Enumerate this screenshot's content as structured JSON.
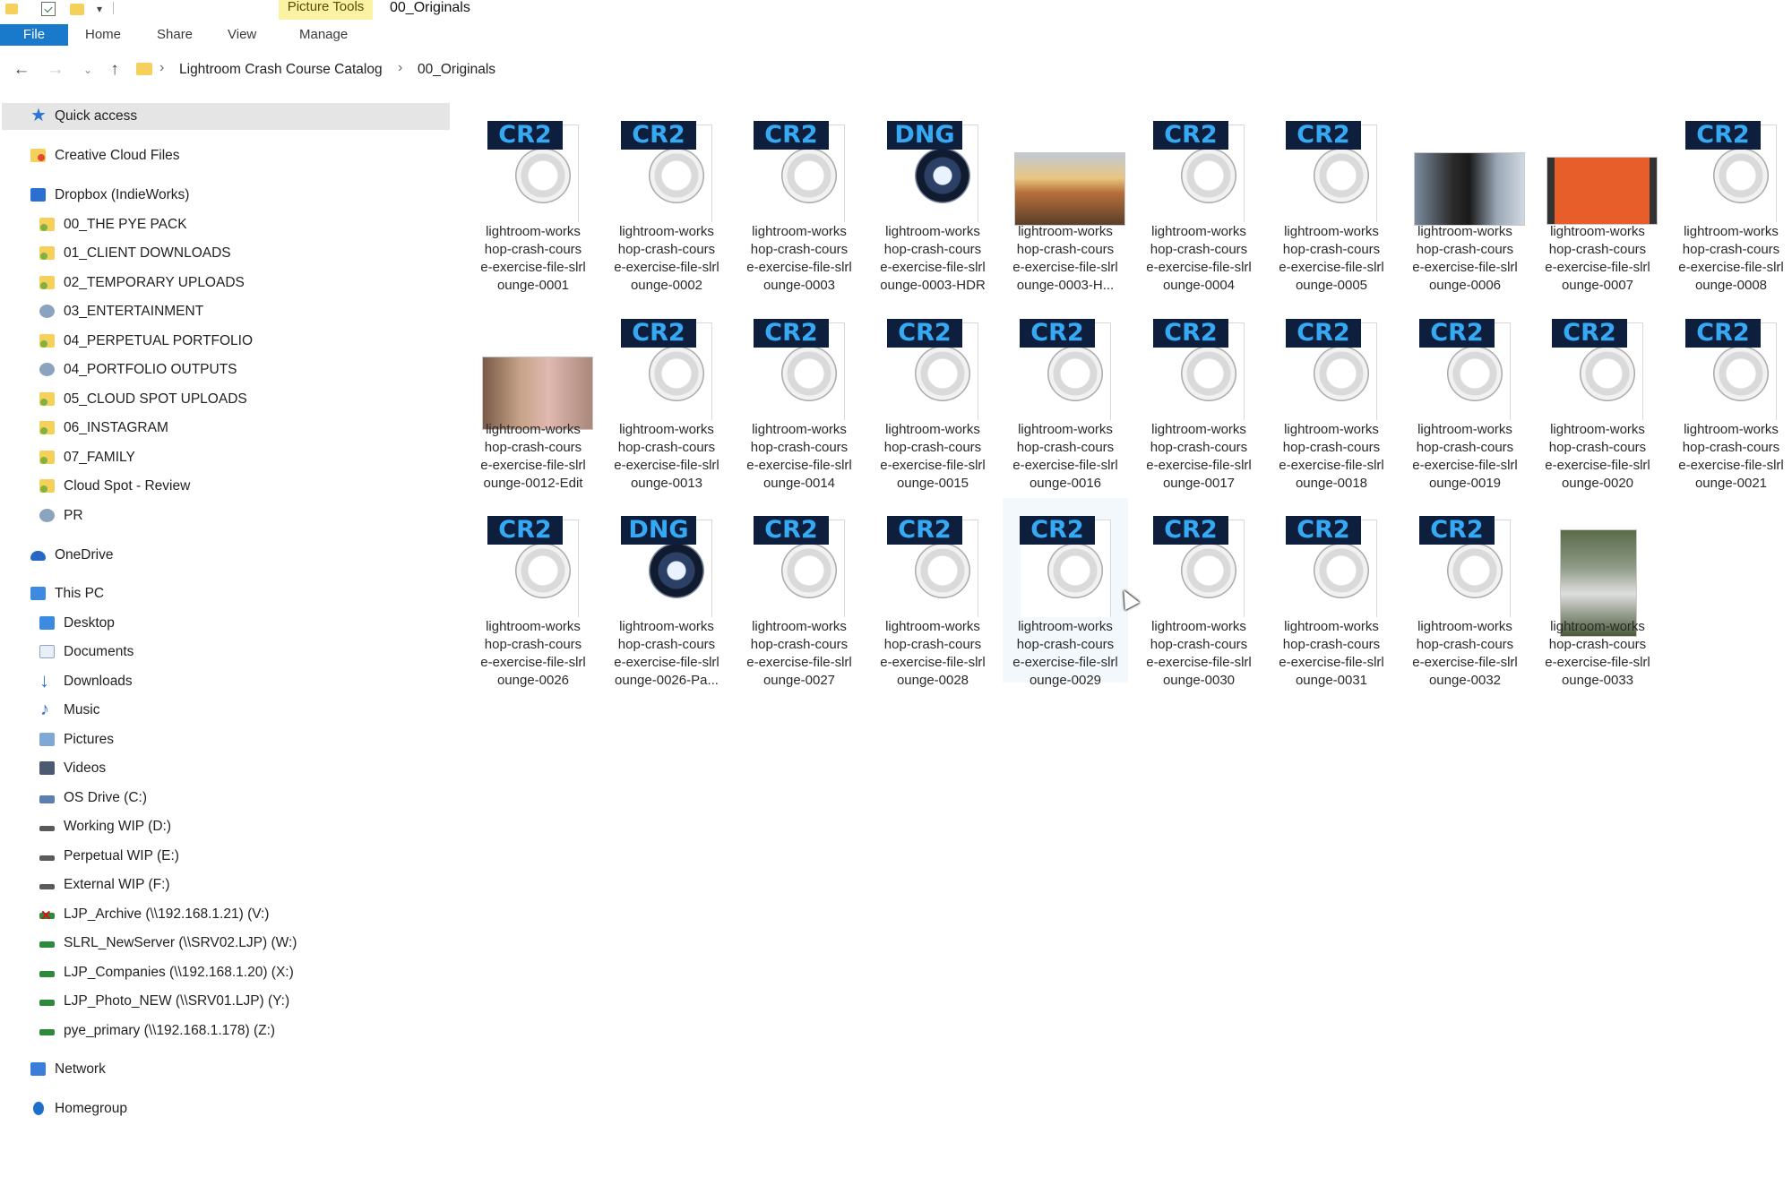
{
  "titlebar": {
    "context_tab": "Picture Tools",
    "window_title": "00_Originals"
  },
  "ribbon": {
    "tabs": [
      "File",
      "Home",
      "Share",
      "View",
      "Manage"
    ]
  },
  "address": {
    "crumbs": [
      "Lightroom Crash Course Catalog",
      "00_Originals"
    ]
  },
  "nav": {
    "quick_access": "Quick access",
    "creative_cloud": "Creative Cloud Files",
    "dropbox": "Dropbox (IndieWorks)",
    "dropbox_folders": [
      "00_THE PYE PACK",
      "01_CLIENT DOWNLOADS",
      "02_TEMPORARY UPLOADS",
      "03_ENTERTAINMENT",
      "04_PERPETUAL PORTFOLIO",
      "04_PORTFOLIO OUTPUTS",
      "05_CLOUD SPOT UPLOADS",
      "06_INSTAGRAM",
      "07_FAMILY",
      "Cloud Spot - Review",
      "PR"
    ],
    "onedrive": "OneDrive",
    "this_pc": "This PC",
    "pc_items": [
      "Desktop",
      "Documents",
      "Downloads",
      "Music",
      "Pictures",
      "Videos",
      "OS Drive (C:)",
      "Working WIP (D:)",
      "Perpetual WIP (E:)",
      "External WIP (F:)",
      "LJP_Archive (\\\\192.168.1.21) (V:)",
      "SLRL_NewServer (\\\\SRV02.LJP) (W:)",
      "LJP_Companies (\\\\192.168.1.20) (X:)",
      "LJP_Photo_NEW (\\\\SRV01.LJP) (Y:)",
      "pye_primary (\\\\192.168.1.178) (Z:)"
    ],
    "network": "Network",
    "homegroup": "Homegroup"
  },
  "files": [
    {
      "type": "CR2",
      "lines": [
        "lightroom-works",
        "hop-crash-cours",
        "e-exercise-file-slrl",
        "ounge-0001"
      ]
    },
    {
      "type": "CR2",
      "lines": [
        "lightroom-works",
        "hop-crash-cours",
        "e-exercise-file-slrl",
        "ounge-0002"
      ]
    },
    {
      "type": "CR2",
      "lines": [
        "lightroom-works",
        "hop-crash-cours",
        "e-exercise-file-slrl",
        "ounge-0003"
      ]
    },
    {
      "type": "DNG",
      "lines": [
        "lightroom-works",
        "hop-crash-cours",
        "e-exercise-file-slrl",
        "ounge-0003-HDR"
      ]
    },
    {
      "type": "photo",
      "lines": [
        "lightroom-works",
        "hop-crash-cours",
        "e-exercise-file-slrl",
        "ounge-0003-H..."
      ]
    },
    {
      "type": "CR2",
      "lines": [
        "lightroom-works",
        "hop-crash-cours",
        "e-exercise-file-slrl",
        "ounge-0004"
      ]
    },
    {
      "type": "CR2",
      "lines": [
        "lightroom-works",
        "hop-crash-cours",
        "e-exercise-file-slrl",
        "ounge-0005"
      ]
    },
    {
      "type": "photo",
      "lines": [
        "lightroom-works",
        "hop-crash-cours",
        "e-exercise-file-slrl",
        "ounge-0006"
      ]
    },
    {
      "type": "photo",
      "lines": [
        "lightroom-works",
        "hop-crash-cours",
        "e-exercise-file-slrl",
        "ounge-0007"
      ]
    },
    {
      "type": "CR2",
      "lines": [
        "lightroom-works",
        "hop-crash-cours",
        "e-exercise-file-slrl",
        "ounge-0008"
      ]
    },
    {
      "type": "photo",
      "lines": [
        "lightroom-works",
        "hop-crash-cours",
        "e-exercise-file-slrl",
        "ounge-0012-Edit"
      ]
    },
    {
      "type": "CR2",
      "lines": [
        "lightroom-works",
        "hop-crash-cours",
        "e-exercise-file-slrl",
        "ounge-0013"
      ]
    },
    {
      "type": "CR2",
      "lines": [
        "lightroom-works",
        "hop-crash-cours",
        "e-exercise-file-slrl",
        "ounge-0014"
      ]
    },
    {
      "type": "CR2",
      "lines": [
        "lightroom-works",
        "hop-crash-cours",
        "e-exercise-file-slrl",
        "ounge-0015"
      ]
    },
    {
      "type": "CR2",
      "lines": [
        "lightroom-works",
        "hop-crash-cours",
        "e-exercise-file-slrl",
        "ounge-0016"
      ]
    },
    {
      "type": "CR2",
      "lines": [
        "lightroom-works",
        "hop-crash-cours",
        "e-exercise-file-slrl",
        "ounge-0017"
      ]
    },
    {
      "type": "CR2",
      "lines": [
        "lightroom-works",
        "hop-crash-cours",
        "e-exercise-file-slrl",
        "ounge-0018"
      ]
    },
    {
      "type": "CR2",
      "lines": [
        "lightroom-works",
        "hop-crash-cours",
        "e-exercise-file-slrl",
        "ounge-0019"
      ]
    },
    {
      "type": "CR2",
      "lines": [
        "lightroom-works",
        "hop-crash-cours",
        "e-exercise-file-slrl",
        "ounge-0020"
      ]
    },
    {
      "type": "CR2",
      "lines": [
        "lightroom-works",
        "hop-crash-cours",
        "e-exercise-file-slrl",
        "ounge-0021"
      ]
    },
    {
      "type": "CR2",
      "lines": [
        "lightroom-works",
        "hop-crash-cours",
        "e-exercise-file-slrl",
        "ounge-0026"
      ]
    },
    {
      "type": "DNG",
      "lines": [
        "lightroom-works",
        "hop-crash-cours",
        "e-exercise-file-slrl",
        "ounge-0026-Pa..."
      ]
    },
    {
      "type": "CR2",
      "lines": [
        "lightroom-works",
        "hop-crash-cours",
        "e-exercise-file-slrl",
        "ounge-0027"
      ]
    },
    {
      "type": "CR2",
      "lines": [
        "lightroom-works",
        "hop-crash-cours",
        "e-exercise-file-slrl",
        "ounge-0028"
      ]
    },
    {
      "type": "CR2",
      "selected": true,
      "lines": [
        "lightroom-works",
        "hop-crash-cours",
        "e-exercise-file-slrl",
        "ounge-0029"
      ]
    },
    {
      "type": "CR2",
      "lines": [
        "lightroom-works",
        "hop-crash-cours",
        "e-exercise-file-slrl",
        "ounge-0030"
      ]
    },
    {
      "type": "CR2",
      "lines": [
        "lightroom-works",
        "hop-crash-cours",
        "e-exercise-file-slrl",
        "ounge-0031"
      ]
    },
    {
      "type": "CR2",
      "lines": [
        "lightroom-works",
        "hop-crash-cours",
        "e-exercise-file-slrl",
        "ounge-0032"
      ]
    },
    {
      "type": "photo",
      "lines": [
        "lightroom-works",
        "hop-crash-cours",
        "e-exercise-file-slrl",
        "ounge-0033"
      ]
    }
  ],
  "colors": {
    "file_tab": "#1979ca",
    "context_tab": "#fbf3a3",
    "badge_bg": "#0e1f3d",
    "badge_text": "#36a9f4"
  }
}
